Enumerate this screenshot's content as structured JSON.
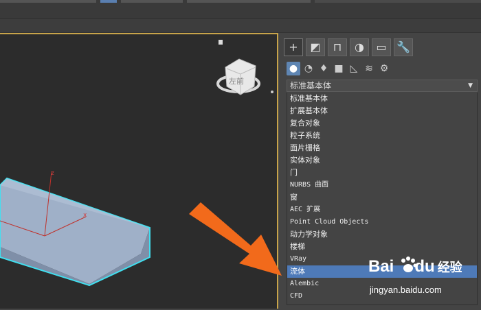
{
  "panel": {
    "tabs": [
      "+",
      "◩",
      "⊓",
      "◑",
      "▭",
      "🔧"
    ],
    "category_icons": [
      "sphere-icon",
      "shapes-icon",
      "light-icon",
      "camera-icon",
      "helper-icon",
      "spacewarp-icon",
      "systems-icon"
    ],
    "dropdown_value": "标准基本体",
    "list_items": [
      {
        "label": "标准基本体",
        "mono": false
      },
      {
        "label": "扩展基本体",
        "mono": false
      },
      {
        "label": "复合对象",
        "mono": false
      },
      {
        "label": "粒子系统",
        "mono": false
      },
      {
        "label": "面片栅格",
        "mono": false
      },
      {
        "label": "实体对象",
        "mono": false
      },
      {
        "label": "门",
        "mono": false
      },
      {
        "label": "NURBS 曲面",
        "mono": true
      },
      {
        "label": "窗",
        "mono": false
      },
      {
        "label": "AEC 扩展",
        "mono": true
      },
      {
        "label": "Point Cloud Objects",
        "mono": true
      },
      {
        "label": "动力学对象",
        "mono": false
      },
      {
        "label": "楼梯",
        "mono": false
      },
      {
        "label": "VRay",
        "mono": true
      },
      {
        "label": "流体",
        "mono": false
      },
      {
        "label": "Alembic",
        "mono": true
      },
      {
        "label": "CFD",
        "mono": true
      }
    ],
    "selected_index": 14
  },
  "viewport": {
    "axis_x": "x",
    "axis_z": "z",
    "viewcube_face": "左前"
  },
  "watermark": {
    "logo": "Bai",
    "logo2": "du",
    "cn": "经验",
    "url": "jingyan.baidu.com"
  },
  "colors": {
    "selection": "#4e7ab8",
    "viewport_border": "#c8a44a",
    "arrow": "#f26a1b",
    "object_edge": "#40e0f0"
  }
}
